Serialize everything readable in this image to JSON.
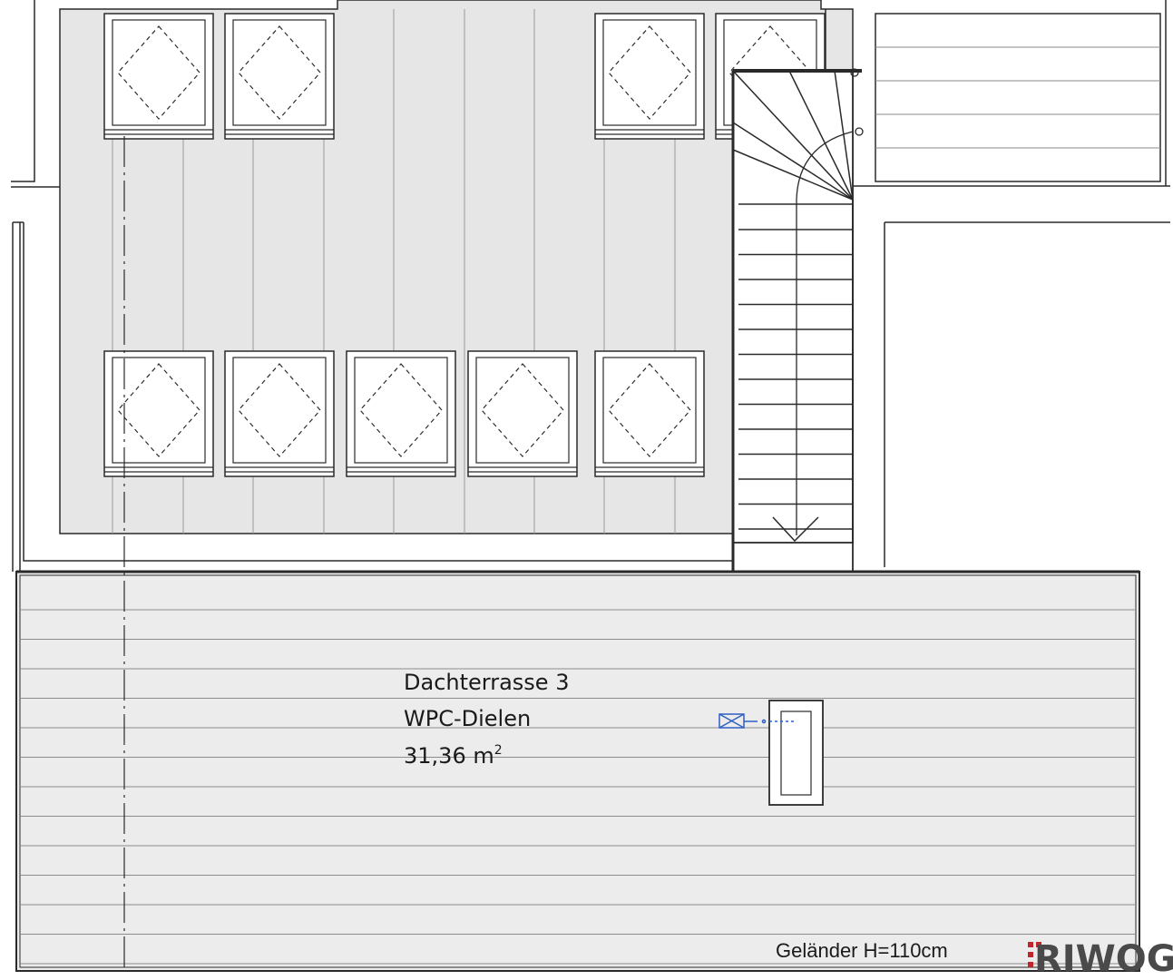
{
  "room": {
    "name": "Dachterrasse 3",
    "material": "WPC-Dielen",
    "area_value": "31,36 m",
    "area_unit_sup": "2"
  },
  "railing_label": "Geländer H=110cm",
  "logo": {
    "text": "RIWOG",
    "accent_color": "#c0272d",
    "text_color": "#4a4a4a"
  },
  "colors": {
    "roof_fill": "#e6e6e6",
    "terrace_fill": "#ececec",
    "line": "#2a2a2a",
    "drain_symbol": "#2f5fc4"
  },
  "icons": {
    "skylight": "dashed-diamond-window-icon",
    "stair": "stair-arrow-icon",
    "drain": "drain-symbol-icon"
  }
}
